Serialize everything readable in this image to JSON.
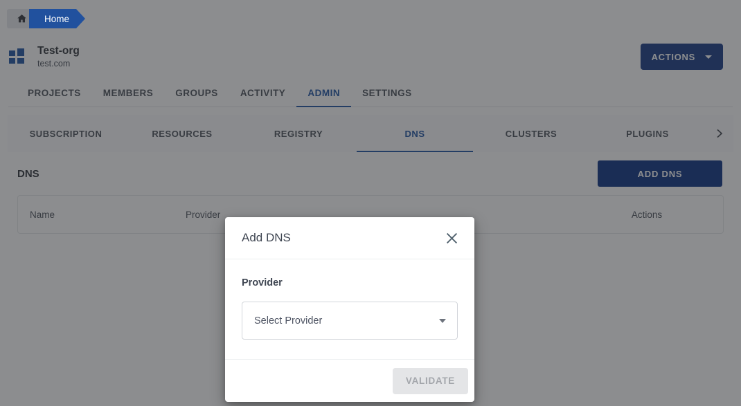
{
  "breadcrumb": {
    "home_icon": "home-icon",
    "items": [
      {
        "label": "Home"
      }
    ]
  },
  "org_header": {
    "logo_icon": "org-grid-logo-icon",
    "name": "Test-org",
    "domain": "test.com",
    "actions_label": "ACTIONS",
    "actions_caret_icon": "chevron-down-icon"
  },
  "nav_tabs": [
    {
      "label": "PROJECTS",
      "active": false
    },
    {
      "label": "MEMBERS",
      "active": false
    },
    {
      "label": "GROUPS",
      "active": false
    },
    {
      "label": "ACTIVITY",
      "active": false
    },
    {
      "label": "ADMIN",
      "active": true
    },
    {
      "label": "SETTINGS",
      "active": false
    }
  ],
  "sub_tabs": [
    {
      "label": "SUBSCRIPTION",
      "active": false
    },
    {
      "label": "RESOURCES",
      "active": false
    },
    {
      "label": "REGISTRY",
      "active": false
    },
    {
      "label": "DNS",
      "active": true
    },
    {
      "label": "CLUSTERS",
      "active": false
    },
    {
      "label": "PLUGINS",
      "active": false
    }
  ],
  "sub_tabs_next_icon": "chevron-right-icon",
  "section": {
    "title": "DNS",
    "add_button_label": "ADD DNS"
  },
  "table": {
    "columns": [
      {
        "label": "Name"
      },
      {
        "label": "Provider"
      },
      {
        "label": ""
      },
      {
        "label": "Actions"
      }
    ],
    "rows": []
  },
  "modal": {
    "title": "Add DNS",
    "close_icon": "close-icon",
    "field_label": "Provider",
    "select_value": "Select Provider",
    "select_caret_icon": "caret-down-icon",
    "validate_label": "VALIDATE"
  },
  "colors": {
    "accent_blue": "#2155a5",
    "button_blue": "#0d3484",
    "actions_blue": "#1b3d87",
    "breadcrumb_blue": "#21519e",
    "text_dark": "#32373d",
    "text_muted": "#4d535c",
    "disabled_bg": "#e4e5e7",
    "disabled_text": "#a3a6ab",
    "scrim": "rgba(38,40,44,0.53)"
  }
}
